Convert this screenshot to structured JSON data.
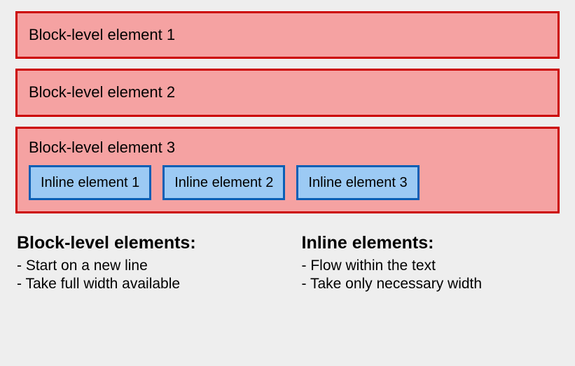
{
  "blocks": [
    {
      "label": "Block-level element 1"
    },
    {
      "label": "Block-level element 2"
    },
    {
      "label": "Block-level element 3"
    }
  ],
  "inline_elements": [
    {
      "label": "Inline element 1"
    },
    {
      "label": "Inline element 2"
    },
    {
      "label": "Inline element 3"
    }
  ],
  "notes": {
    "block": {
      "heading": "Block-level elements:",
      "points": [
        "- Start on a new line",
        "- Take full width available"
      ]
    },
    "inline": {
      "heading": "Inline elements:",
      "points": [
        "- Flow within the text",
        "- Take only necessary width"
      ]
    }
  }
}
